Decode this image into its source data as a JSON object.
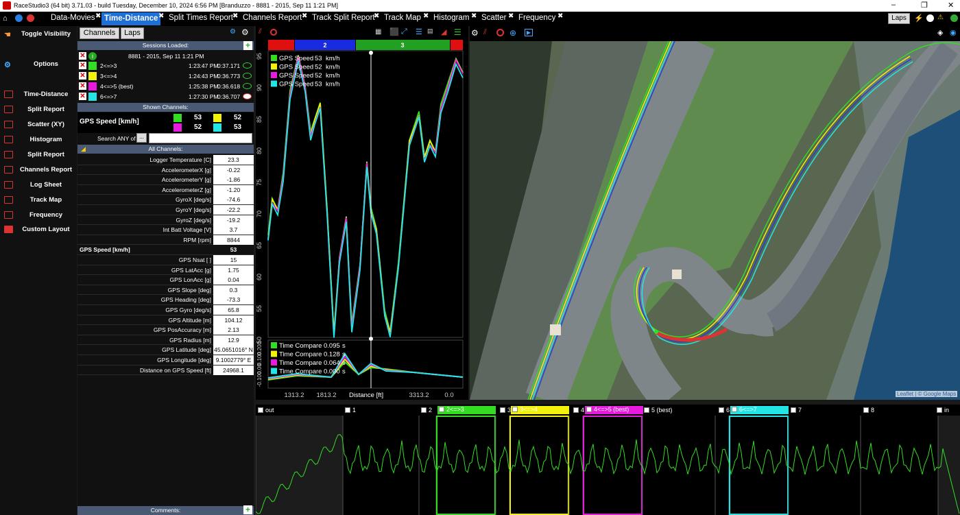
{
  "window": {
    "title": "RaceStudio3 (64 bit) 3.71.03 - build Tuesday, December 10, 2024 6:56 PM [Branduzzo - 8881 - 2015, Sep 11 1:21 PM]",
    "minimize": "–",
    "maximize": "❐",
    "close": "✕"
  },
  "tabs": [
    {
      "label": "Data-Movies"
    },
    {
      "label": "Time-Distance"
    },
    {
      "label": "Split Times Report"
    },
    {
      "label": "Channels Report"
    },
    {
      "label": "Track Split Report"
    },
    {
      "label": "Track Map"
    },
    {
      "label": "Histogram"
    },
    {
      "label": "Scatter"
    },
    {
      "label": "Frequency"
    }
  ],
  "laps_button": "Laps",
  "nav": {
    "toggle": "Toggle Visibility",
    "options": "Options",
    "items": [
      "Time-Distance",
      "Split Report",
      "Scatter (XY)",
      "Histogram",
      "Split Report",
      "Channels Report",
      "Log Sheet",
      "Track Map",
      "Frequency",
      "Custom Layout"
    ]
  },
  "channels_panel": {
    "channels_btn": "Channels",
    "laps_btn": "Laps",
    "sessions_loaded": "Sessions Loaded:",
    "session_name": "8881 - 2015, Sep 11 1:21 PM",
    "laps": [
      {
        "name": "2<=>3",
        "time": "1:23:47 PM",
        "lap": "0:37.171",
        "color": "#33dd22"
      },
      {
        "name": "3<=>4",
        "time": "1:24:43 PM",
        "lap": "0:36.773",
        "color": "#f2f20a"
      },
      {
        "name": "4<=>5 (best)",
        "time": "1:25:38 PM",
        "lap": "0:36.618",
        "color": "#e81ae0"
      },
      {
        "name": "6<=>7",
        "time": "1:27:30 PM",
        "lap": "0:36.707",
        "color": "#22e6e6"
      }
    ],
    "shown_channels": "Shown Channels:",
    "shown_name": "GPS Speed [km/h]",
    "shown_values": [
      "53",
      "52",
      "52",
      "53"
    ],
    "search_label": "Search ANY of",
    "search_btn": "...",
    "search_value": "",
    "all_channels": "All Channels:",
    "rows": [
      {
        "n": "Logger Temperature [C]",
        "v": "23.3"
      },
      {
        "n": "AccelerometerX [g]",
        "v": "-0.22"
      },
      {
        "n": "AccelerometerY [g]",
        "v": "-1.86"
      },
      {
        "n": "AccelerometerZ [g]",
        "v": "-1.20"
      },
      {
        "n": "GyroX [deg/s]",
        "v": "-74.6"
      },
      {
        "n": "GyroY [deg/s]",
        "v": "-22.2"
      },
      {
        "n": "GyroZ [deg/s]",
        "v": "-19.2"
      },
      {
        "n": "Int Batt Voltage [V]",
        "v": "3.7"
      },
      {
        "n": "RPM [rpm]",
        "v": "8844"
      },
      {
        "n": "GPS Speed [km/h]",
        "v": "53",
        "bold": true
      },
      {
        "n": "GPS Nsat [ ]",
        "v": "15"
      },
      {
        "n": "GPS LatAcc [g]",
        "v": "1.75"
      },
      {
        "n": "GPS LonAcc [g]",
        "v": "0.04"
      },
      {
        "n": "GPS Slope [deg]",
        "v": "0.3"
      },
      {
        "n": "GPS Heading [deg]",
        "v": "-73.3"
      },
      {
        "n": "GPS Gyro [deg/s]",
        "v": "65.8"
      },
      {
        "n": "GPS Altitude [m]",
        "v": "104.12"
      },
      {
        "n": "GPS PosAccuracy [m]",
        "v": "2.13"
      },
      {
        "n": "GPS Radius [m]",
        "v": "12.9"
      },
      {
        "n": "GPS Latitude [deg]",
        "v": "45.0651016° N"
      },
      {
        "n": "GPS Longitude [deg]",
        "v": "9.1002779° E"
      },
      {
        "n": "Distance on GPS Speed [ft]",
        "v": "24968.1"
      }
    ],
    "comments": "Comments:"
  },
  "chart": {
    "splits": [
      "2",
      "3"
    ],
    "speed_legend": [
      {
        "name": "GPS Speed",
        "val": "53",
        "unit": "km/h",
        "color": "#33dd22"
      },
      {
        "name": "GPS Speed",
        "val": "52",
        "unit": "km/h",
        "color": "#f2f20a"
      },
      {
        "name": "GPS Speed",
        "val": "52",
        "unit": "km/h",
        "color": "#e81ae0"
      },
      {
        "name": "GPS Speed",
        "val": "53",
        "unit": "km/h",
        "color": "#22e6e6"
      }
    ],
    "tc_legend": [
      {
        "name": "Time Compare",
        "val": "0.095",
        "unit": "s",
        "color": "#33dd22"
      },
      {
        "name": "Time Compare",
        "val": "0.128",
        "unit": "s",
        "color": "#f2f20a"
      },
      {
        "name": "Time Compare",
        "val": "0.064",
        "unit": "s",
        "color": "#e81ae0"
      },
      {
        "name": "Time Compare",
        "val": "0.000",
        "unit": "s",
        "color": "#22e6e6"
      }
    ],
    "y_ticks": [
      "95",
      "90",
      "85",
      "80",
      "75",
      "70",
      "65",
      "60",
      "55",
      "50"
    ],
    "tc_ticks": [
      "0.200",
      "0.100",
      "0.00",
      "-0.100"
    ],
    "x_ticks": [
      "1313.2",
      "1813.2",
      "3313.2",
      "0.0"
    ],
    "x_label": "Distance [ft]"
  },
  "map": {
    "attribution": "Leaflet | © Google Maps"
  },
  "lap_strip": {
    "labels": [
      "out",
      "1",
      "2",
      "2<=>3",
      "3",
      "3<=>4",
      "4",
      "4<=>5 (best)",
      "5 (best)",
      "6",
      "6<=>7",
      "7",
      "8",
      "in"
    ]
  }
}
